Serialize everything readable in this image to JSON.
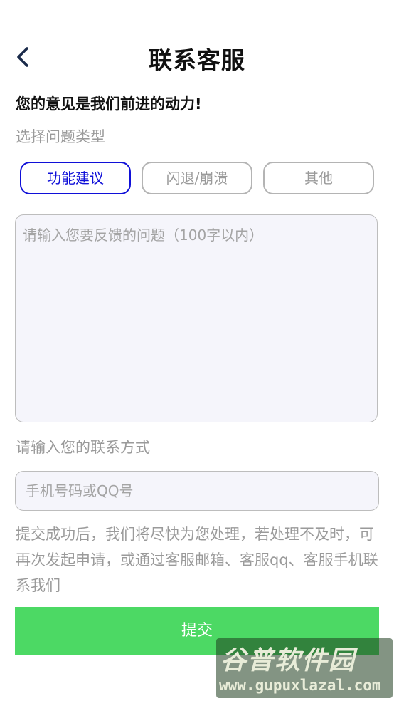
{
  "header": {
    "title": "联系客服",
    "back_icon": "chevron-left-icon"
  },
  "slogan": "您的意见是我们前进的动力!",
  "problem_type": {
    "label": "选择问题类型",
    "options": [
      {
        "label": "功能建议",
        "selected": true
      },
      {
        "label": "闪退/崩溃",
        "selected": false
      },
      {
        "label": "其他",
        "selected": false
      }
    ]
  },
  "feedback": {
    "placeholder": "请输入您要反馈的问题（100字以内）",
    "value": ""
  },
  "contact": {
    "label": "请输入您的联系方式",
    "placeholder": "手机号码或QQ号",
    "value": ""
  },
  "note": "提交成功后，我们将尽快为您处理，若处理不及时，可再次发起申请，或通过客服邮箱、客服qq、客服手机联系我们",
  "submit_label": "提交",
  "watermark": {
    "brand": "谷普软件园",
    "url": "www.gupuxlazal.com"
  },
  "colors": {
    "accent": "#1010d8",
    "submit": "#4cd964",
    "muted_text": "#9a9a9a",
    "input_bg": "#f5f5fb"
  }
}
